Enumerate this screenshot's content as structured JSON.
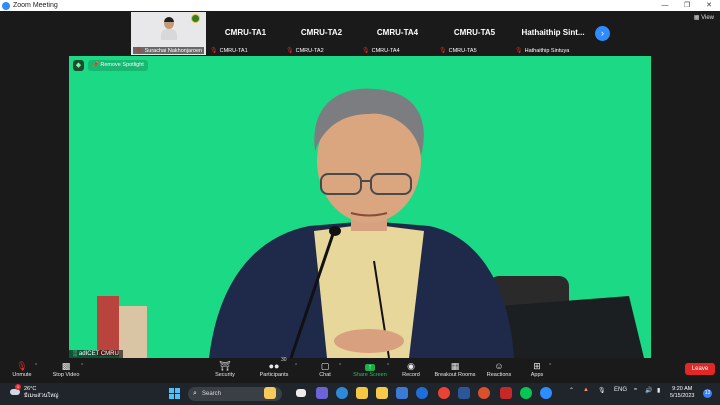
{
  "window": {
    "title": "Zoom Meeting",
    "min": "—",
    "max": "❐",
    "close": "✕"
  },
  "view_label": "View",
  "gallery": [
    {
      "center_name": "",
      "tag": "Surachai Nakhonjaroen"
    },
    {
      "center_name": "CMRU-TA1",
      "tag": "CMRU-TA1"
    },
    {
      "center_name": "CMRU-TA2",
      "tag": "CMRU-TA2"
    },
    {
      "center_name": "CMRU-TA4",
      "tag": "CMRU-TA4"
    },
    {
      "center_name": "CMRU-TA5",
      "tag": "CMRU-TA5"
    },
    {
      "center_name": "Hathaithip  Sint...",
      "tag": "Hathaithip Sintuya"
    }
  ],
  "main": {
    "spotlight_label": "Remove Spotlight",
    "speaker_name": "adICET CMRU"
  },
  "toolbar": {
    "unmute": "Unmute",
    "stop_video": "Stop Video",
    "security": "Security",
    "participants": "Participants",
    "participants_count": "30",
    "chat": "Chat",
    "share_screen": "Share Screen",
    "record": "Record",
    "breakout_rooms": "Breakout Rooms",
    "reactions": "Reactions",
    "apps": "Apps",
    "leave": "Leave"
  },
  "taskbar": {
    "temperature": "26°C",
    "weather_desc": "มีเมฆส่วนใหญ่",
    "search_placeholder": "Search",
    "language": "ENG",
    "time": "9:20 AM",
    "date": "5/15/2023",
    "notification_count": "13",
    "alert_count": "1"
  },
  "colors": {
    "green_screen": "#1cd985",
    "zoom_blue": "#2d8cff",
    "leave_red": "#e02828",
    "share_green": "#1dae4c"
  }
}
